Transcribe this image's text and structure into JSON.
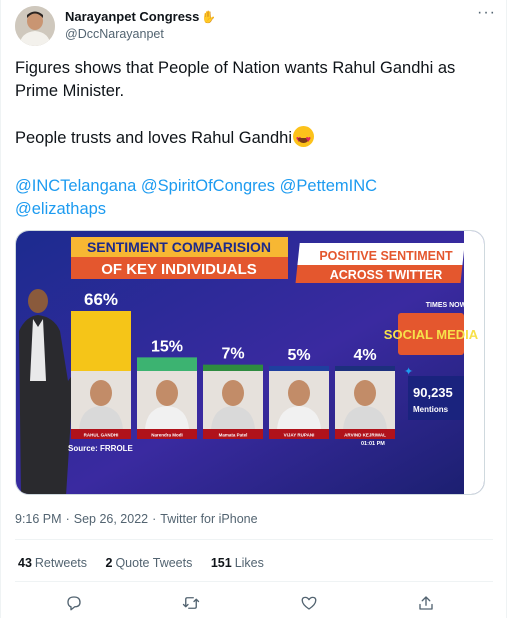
{
  "author": {
    "display_name": "Narayanpet Congress",
    "handle": "@DccNarayanpet"
  },
  "tweet": {
    "line1": "Figures shows that People of Nation wants Rahul Gandhi as Prime Minister.",
    "line2": "People trusts and loves Rahul Gandhi",
    "mentions": [
      "@INCTelangana",
      "@SpiritOfCongres",
      "@PettemINC",
      "@elizathaps"
    ]
  },
  "media": {
    "chart_data": {
      "type": "bar",
      "title": "SENTIMENT COMPARISION OF KEY INDIVIDUALS",
      "banner": "POSITIVE SENTIMENT ACROSS TWITTER",
      "categories": [
        "RAHUL GANDHI",
        "Narendra Modi",
        "Mamata Patel",
        "VIJAY RUPANI",
        "ARVIND KEJRIWAL"
      ],
      "values": [
        66,
        15,
        7,
        5,
        4
      ],
      "value_labels": [
        "66%",
        "15%",
        "7%",
        "5%",
        "4%"
      ],
      "source": "Source: FRROLE",
      "twitter_mentions": "90,235",
      "mentions_label": "Mentions",
      "time": "01:01 PM",
      "channel": "TIMES NOW",
      "segment": "SOCIAL MEDIA",
      "bar_colors": [
        "#f5c518",
        "#3cb371",
        "#2e8b3f",
        "#1f3f9f",
        "#1d2f7d"
      ]
    }
  },
  "meta": {
    "time": "9:16 PM",
    "date": "Sep 26, 2022",
    "client": "Twitter for iPhone"
  },
  "stats": {
    "retweets_count": "43",
    "retweets_label": "Retweets",
    "quotes_count": "2",
    "quotes_label": "Quote Tweets",
    "likes_count": "151",
    "likes_label": "Likes"
  },
  "icons": [
    "reply-icon",
    "retweet-icon",
    "like-icon",
    "share-icon",
    "more-icon"
  ],
  "colors": {
    "link": "#1d9bf0",
    "secondary": "#536471",
    "text": "#0f1419"
  }
}
